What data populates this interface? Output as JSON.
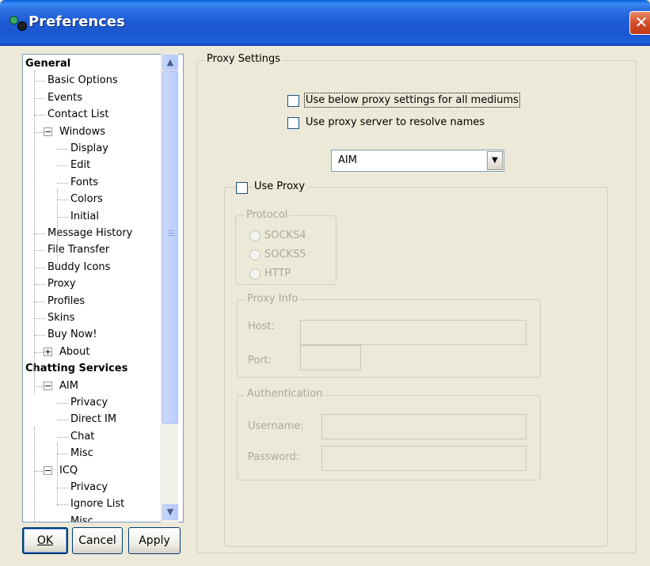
{
  "window": {
    "title": "Preferences",
    "close_glyph": "✕"
  },
  "tree": {
    "items": [
      {
        "label": "General",
        "bold": true
      },
      {
        "label": "Basic Options"
      },
      {
        "label": "Events"
      },
      {
        "label": "Contact List"
      },
      {
        "label": "Windows"
      },
      {
        "label": "Display"
      },
      {
        "label": "Edit"
      },
      {
        "label": "Fonts"
      },
      {
        "label": "Colors"
      },
      {
        "label": "Initial"
      },
      {
        "label": "Message History"
      },
      {
        "label": "File Transfer"
      },
      {
        "label": "Buddy Icons"
      },
      {
        "label": "Proxy"
      },
      {
        "label": "Profiles"
      },
      {
        "label": "Skins"
      },
      {
        "label": "Buy Now!"
      },
      {
        "label": "About"
      },
      {
        "label": "Chatting Services",
        "bold": true
      },
      {
        "label": "AIM"
      },
      {
        "label": "Privacy"
      },
      {
        "label": "Direct IM"
      },
      {
        "label": "Chat"
      },
      {
        "label": "Misc"
      },
      {
        "label": "ICQ"
      },
      {
        "label": "Privacy"
      },
      {
        "label": "Ignore List"
      },
      {
        "label": "Misc"
      }
    ],
    "selected": "Proxy"
  },
  "buttons": {
    "ok": "OK",
    "cancel": "Cancel",
    "apply": "Apply"
  },
  "proxy_settings": {
    "group_label": "Proxy Settings",
    "use_all_mediums_label": "Use below proxy settings for all mediums",
    "resolve_names_label": "Use proxy server to resolve names",
    "medium_selected": "AIM",
    "use_proxy_label": "Use Proxy",
    "protocol": {
      "label": "Protocol",
      "options": [
        "SOCKS4",
        "SOCKS5",
        "HTTP"
      ]
    },
    "proxy_info": {
      "label": "Proxy Info",
      "host_label": "Host:",
      "port_label": "Port:",
      "host_value": "",
      "port_value": ""
    },
    "authentication": {
      "label": "Authentication",
      "username_label": "Username:",
      "password_label": "Password:",
      "username_value": "",
      "password_value": ""
    }
  },
  "colors": {
    "titlebar": "#2F74E6",
    "close_button": "#D44E2A",
    "dialog_bg": "#ECE9D8",
    "disabled_text": "#ACA899"
  }
}
